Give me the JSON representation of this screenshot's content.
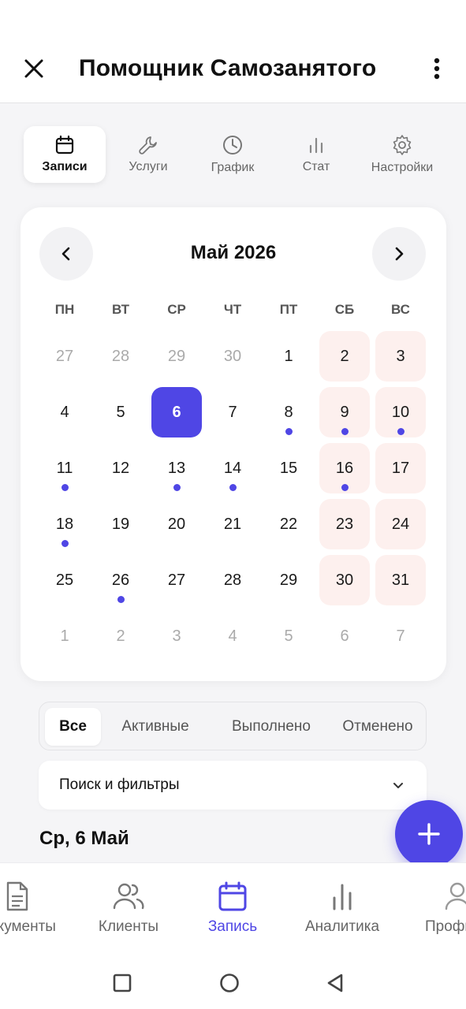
{
  "app": {
    "title": "Помощник Самозанятого"
  },
  "tabs": [
    {
      "label": "Записи",
      "icon": "calendar-icon",
      "active": true
    },
    {
      "label": "Услуги",
      "icon": "wrench-icon",
      "active": false
    },
    {
      "label": "График",
      "icon": "clock-icon",
      "active": false
    },
    {
      "label": "Стат",
      "icon": "bar-chart-icon",
      "active": false
    },
    {
      "label": "Настройки",
      "icon": "gear-icon",
      "active": false
    }
  ],
  "calendar": {
    "month_label": "Май 2026",
    "weekdays": [
      "ПН",
      "ВТ",
      "СР",
      "ЧТ",
      "ПТ",
      "СБ",
      "ВС"
    ],
    "weeks": [
      [
        {
          "d": "27",
          "m": true
        },
        {
          "d": "28",
          "m": true
        },
        {
          "d": "29",
          "m": true
        },
        {
          "d": "30",
          "m": true
        },
        {
          "d": "1"
        },
        {
          "d": "2",
          "w": true
        },
        {
          "d": "3",
          "w": true
        }
      ],
      [
        {
          "d": "4"
        },
        {
          "d": "5"
        },
        {
          "d": "6",
          "sel": true
        },
        {
          "d": "7"
        },
        {
          "d": "8",
          "dot": true
        },
        {
          "d": "9",
          "w": true,
          "dot": true
        },
        {
          "d": "10",
          "w": true,
          "dot": true
        }
      ],
      [
        {
          "d": "11",
          "dot": true
        },
        {
          "d": "12"
        },
        {
          "d": "13",
          "dot": true
        },
        {
          "d": "14",
          "dot": true
        },
        {
          "d": "15"
        },
        {
          "d": "16",
          "w": true,
          "dot": true
        },
        {
          "d": "17",
          "w": true
        }
      ],
      [
        {
          "d": "18",
          "dot": true
        },
        {
          "d": "19"
        },
        {
          "d": "20"
        },
        {
          "d": "21"
        },
        {
          "d": "22"
        },
        {
          "d": "23",
          "w": true
        },
        {
          "d": "24",
          "w": true
        }
      ],
      [
        {
          "d": "25"
        },
        {
          "d": "26",
          "dot": true
        },
        {
          "d": "27"
        },
        {
          "d": "28"
        },
        {
          "d": "29"
        },
        {
          "d": "30",
          "w": true
        },
        {
          "d": "31",
          "w": true
        }
      ],
      [
        {
          "d": "1",
          "m": true
        },
        {
          "d": "2",
          "m": true
        },
        {
          "d": "3",
          "m": true
        },
        {
          "d": "4",
          "m": true
        },
        {
          "d": "5",
          "m": true
        },
        {
          "d": "6",
          "m": true
        },
        {
          "d": "7",
          "m": true
        }
      ]
    ]
  },
  "filters": [
    {
      "label": "Все",
      "active": true
    },
    {
      "label": "Активные",
      "active": false
    },
    {
      "label": "Выполнено",
      "active": false
    },
    {
      "label": "Отменено",
      "active": false
    }
  ],
  "search": {
    "label": "Поиск и фильтры"
  },
  "day_header": "Ср, 6 Май",
  "bottom_nav": [
    {
      "label": "Документы",
      "icon": "document-icon",
      "active": false
    },
    {
      "label": "Клиенты",
      "icon": "users-icon",
      "active": false
    },
    {
      "label": "Запись",
      "icon": "calendar-icon",
      "active": true
    },
    {
      "label": "Аналитика",
      "icon": "bar-chart-icon",
      "active": false
    },
    {
      "label": "Профиль",
      "icon": "profile-icon",
      "active": false
    }
  ],
  "colors": {
    "accent": "#4f46e5",
    "weekend_bg": "#fdf0ee",
    "background": "#f5f5f7"
  }
}
